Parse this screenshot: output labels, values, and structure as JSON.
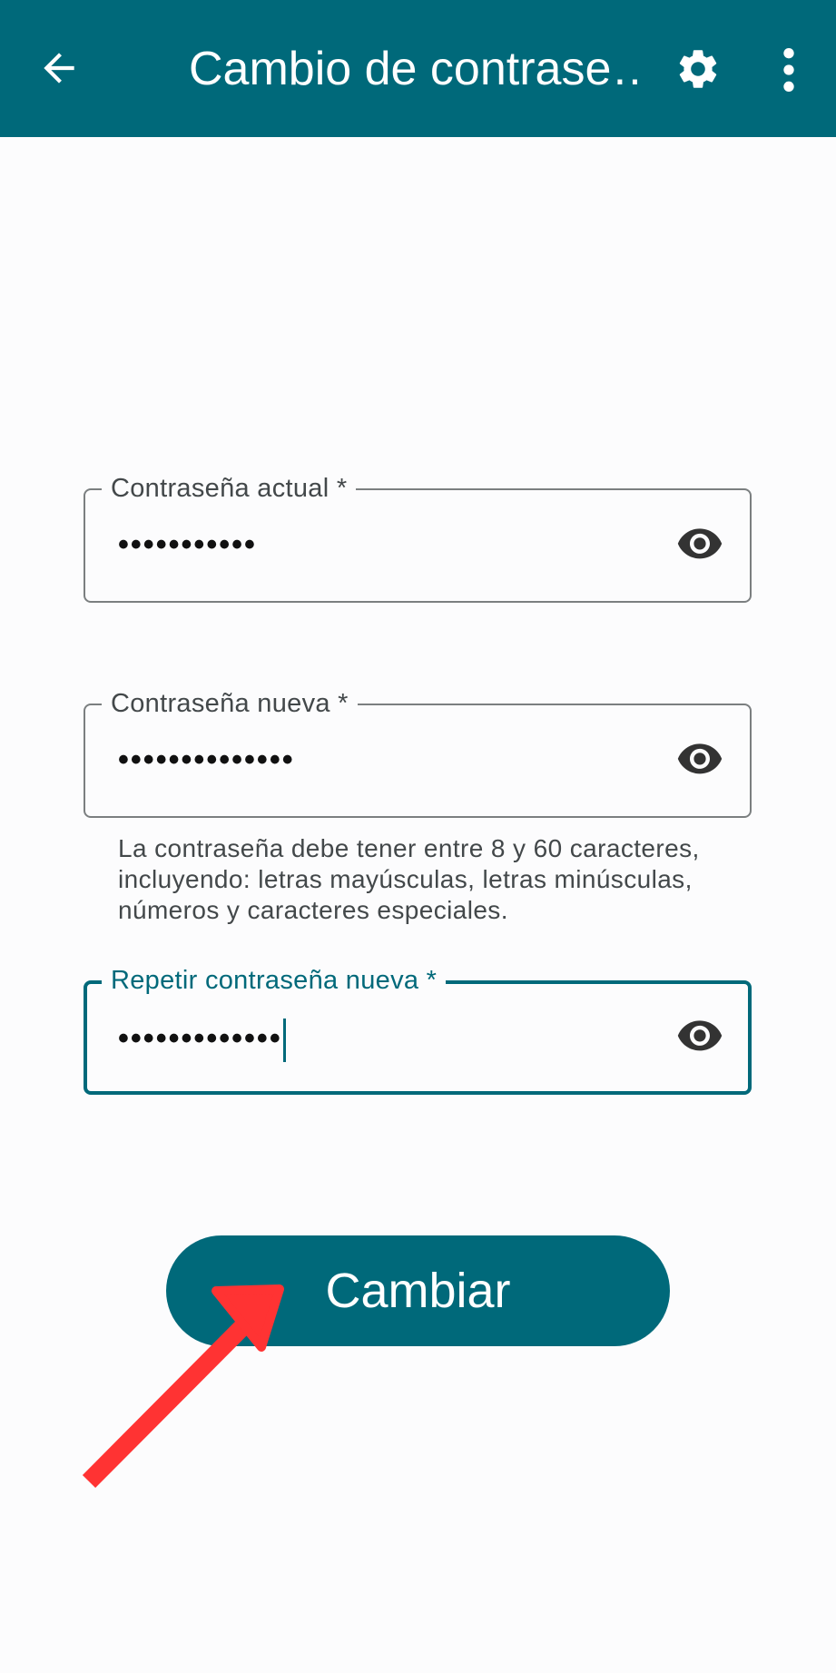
{
  "appbar": {
    "title": "Cambio de contrase…",
    "back_icon": "arrow-back-icon",
    "settings_icon": "gear-icon",
    "more_icon": "more-vert-icon",
    "color": "#00697a"
  },
  "form": {
    "current_password": {
      "label": "Contraseña actual *",
      "value": "•••••••••••",
      "toggle_icon": "eye-icon"
    },
    "new_password": {
      "label": "Contraseña nueva *",
      "value": "••••••••••••••",
      "toggle_icon": "eye-icon",
      "helper": "La contraseña debe tener entre 8 y 60 caracteres, incluyendo: letras mayúsculas, letras minúsculas, números y caracteres especiales."
    },
    "repeat_password": {
      "label": "Repetir contraseña nueva *",
      "value": "•••••••••••••",
      "toggle_icon": "eye-icon",
      "focused": true
    }
  },
  "submit": {
    "label": "Cambiar"
  },
  "annotation": {
    "arrow_icon": "red-arrow-annotation",
    "color": "#ff3333"
  }
}
